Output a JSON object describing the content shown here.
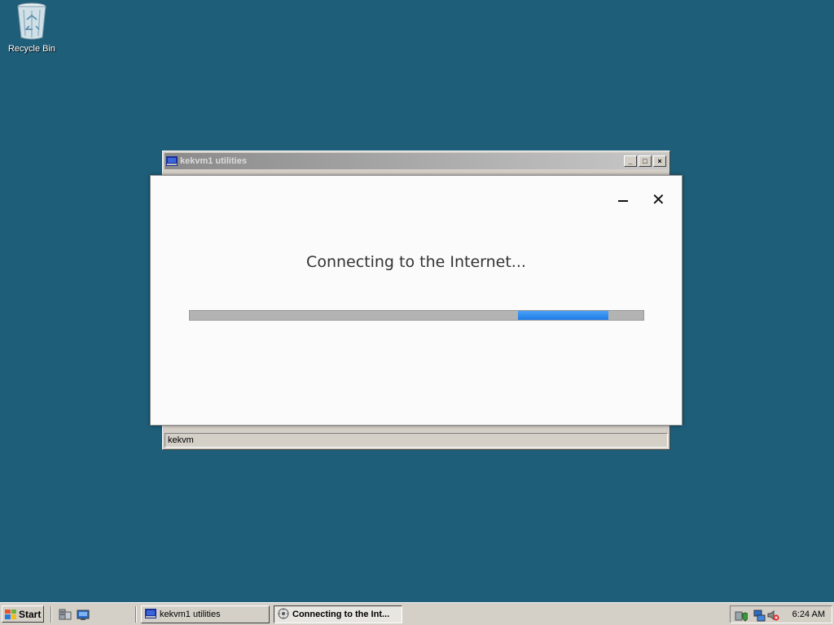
{
  "desktop": {
    "recycle_bin_label": "Recycle Bin"
  },
  "background_window": {
    "title": "kekvm1 utilities",
    "status_text": "kekvm",
    "buttons": {
      "minimize": "_",
      "maximize": "□",
      "close": "×"
    }
  },
  "dialog": {
    "message": "Connecting to the Internet...",
    "close_glyph": "✕",
    "progress_fraction": 0.2
  },
  "taskbar": {
    "start_label": "Start",
    "tasks": [
      {
        "label": "kekvm1 utilities",
        "active": false
      },
      {
        "label": "Connecting to the Int...",
        "active": true
      }
    ],
    "clock": "6:24 AM"
  },
  "colors": {
    "desktop_bg": "#1f5e79",
    "progress_fill": "#2f8cf0",
    "progress_track": "#b3b3b3"
  }
}
